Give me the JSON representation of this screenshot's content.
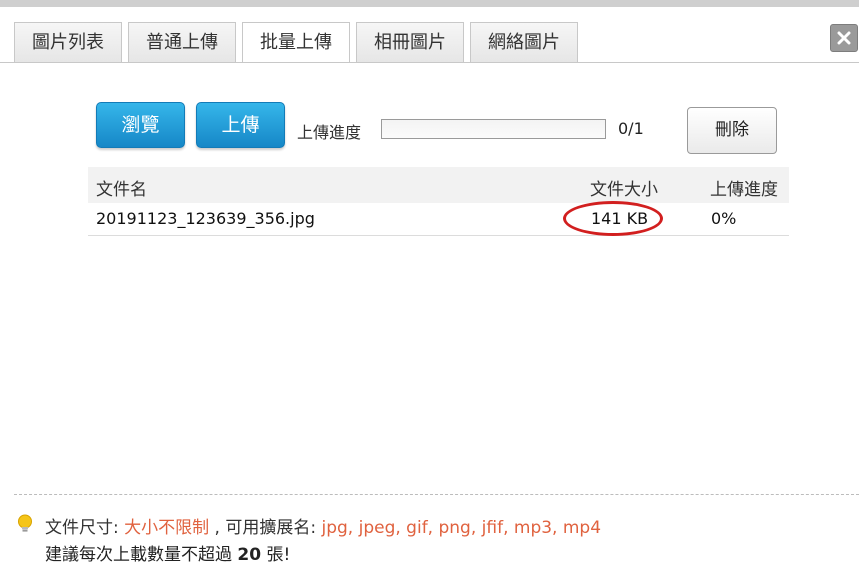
{
  "tabs": [
    "圖片列表",
    "普通上傳",
    "批量上傳",
    "相冊圖片",
    "網絡圖片"
  ],
  "active_tab": 2,
  "buttons": {
    "browse": "瀏覽",
    "upload": "上傳",
    "delete": "刪除"
  },
  "progress": {
    "label": "上傳進度",
    "count": "0/1",
    "fraction": 0
  },
  "table": {
    "headers": {
      "name": "文件名",
      "size": "文件大小",
      "progress": "上傳進度"
    },
    "rows": [
      {
        "name": "20191123_123639_356.jpg",
        "size": "141 KB",
        "progress": "0%"
      }
    ]
  },
  "info": {
    "size_label": "文件尺寸:",
    "size_value": "大小不限制",
    "ext_label": ", 可用擴展名:",
    "ext_value": "jpg, jpeg, gif, png, jfif, mp3, mp4",
    "suggest_pre": "建議每次上載數量不超過",
    "suggest_num": "20",
    "suggest_post": "張!"
  },
  "colors": {
    "accent": "#e0623f",
    "primary": "#1e98d8",
    "highlight": "#d21f1f"
  }
}
